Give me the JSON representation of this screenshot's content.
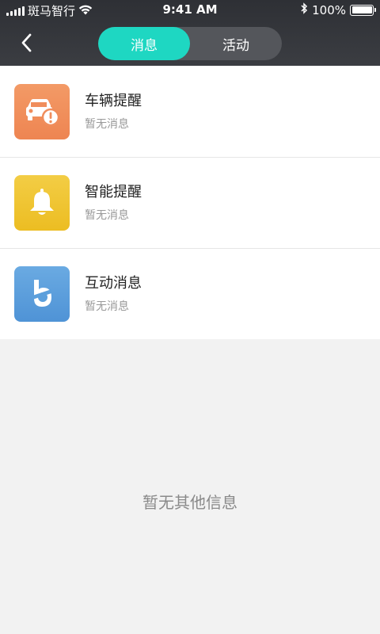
{
  "status_bar": {
    "carrier": "斑马智行",
    "time": "9:41 AM",
    "battery": "100%",
    "icons": [
      "signal-icon",
      "wifi-icon",
      "bluetooth-icon",
      "battery-icon"
    ]
  },
  "nav": {
    "back_icon": "chevron-left-icon",
    "tabs": [
      {
        "label": "消息",
        "active": true
      },
      {
        "label": "活动",
        "active": false
      }
    ]
  },
  "messages": [
    {
      "title": "车辆提醒",
      "subtitle": "暂无消息",
      "icon": "car-alert-icon",
      "color": "#f08d5c"
    },
    {
      "title": "智能提醒",
      "subtitle": "暂无消息",
      "icon": "bell-icon",
      "color": "#efc12c"
    },
    {
      "title": "互动消息",
      "subtitle": "暂无消息",
      "icon": "interaction-logo-icon",
      "color": "#5b9fdc"
    }
  ],
  "empty_text": "暂无其他信息",
  "colors": {
    "header_bg": "#34363b",
    "accent": "#1ed7c2",
    "page_bg": "#f2f2f2"
  }
}
